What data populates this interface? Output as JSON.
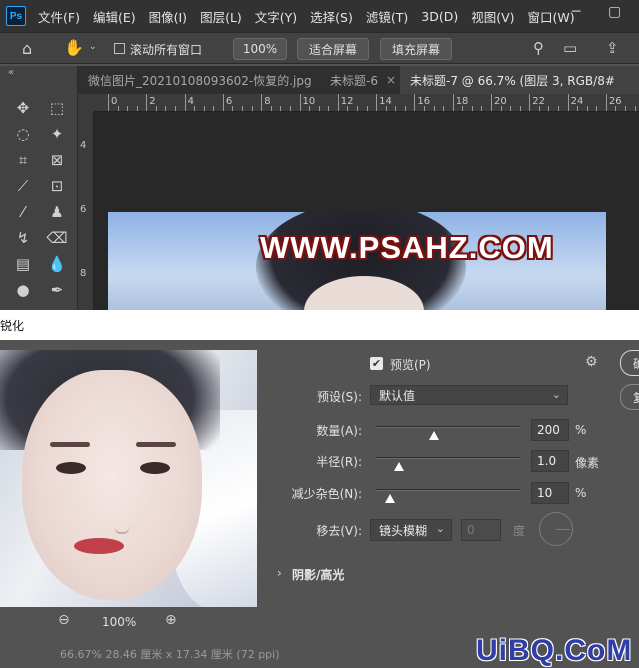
{
  "app": {
    "logo": "Ps"
  },
  "menu": [
    "文件(F)",
    "编辑(E)",
    "图像(I)",
    "图层(L)",
    "文字(Y)",
    "选择(S)",
    "滤镜(T)",
    "3D(D)",
    "视图(V)",
    "窗口(W)"
  ],
  "options": {
    "scroll_all_label": "滚动所有窗口",
    "zoom_value": "100%",
    "fit_screen_label": "适合屏幕",
    "fill_screen_label": "填充屏幕"
  },
  "tabs": [
    {
      "label": "微信图片_20210108093602-恢复的.jpg",
      "close": "×"
    },
    {
      "label": "未标题-6",
      "close": "×"
    },
    {
      "label": "未标题-7 @ 66.7% (图层 3, RGB/8#",
      "close": ""
    }
  ],
  "ruler": {
    "h_labels": [
      "0",
      "2",
      "4",
      "6",
      "8",
      "10",
      "12",
      "14",
      "16",
      "18",
      "20",
      "22",
      "24",
      "26"
    ],
    "v_labels": [
      "4",
      "6",
      "8"
    ]
  },
  "canvas": {
    "watermark": "WWW.PSAHZ.COM"
  },
  "dialog": {
    "title": "锐化",
    "preview_label": "预览(P)",
    "zoom_level": "100%",
    "preset_label": "预设(S):",
    "preset_value": "默认值",
    "amount_label": "数量(A):",
    "amount_value": "200",
    "amount_unit": "%",
    "amount_fraction": 0.4,
    "radius_label": "半径(R):",
    "radius_value": "1.0",
    "radius_unit": "像素",
    "radius_fraction": 0.16,
    "noise_label": "减少杂色(N):",
    "noise_value": "10",
    "noise_unit": "%",
    "noise_fraction": 0.1,
    "remove_label": "移去(V):",
    "remove_value": "镜头模糊",
    "angle_value": "0",
    "angle_unit": "度",
    "shadows_label": "阴影/高光",
    "ok_button": "确",
    "cancel_button": "复"
  },
  "status": {
    "text": "66.67%   28.46 厘米 x 17.34 厘米 (72 ppi)"
  },
  "site_mark": "UiBQ.CoM"
}
